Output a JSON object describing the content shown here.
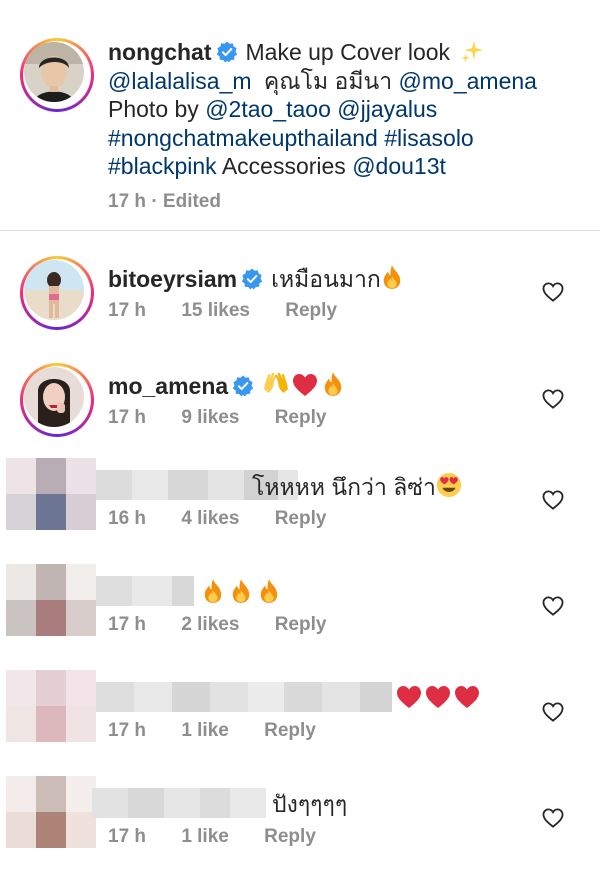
{
  "caption": {
    "username": "nongchat",
    "line1_text": "Make up Cover look",
    "line1_emoji": "sparkles",
    "line2_mention1": "@lalalalisa_m",
    "line2_text": "คุณโม อมีนา",
    "line2_mention2": "@mo_amena",
    "line3_text": "Photo by",
    "line3_mention1": "@2tao_taoo",
    "line3_mention2": "@jjayalus",
    "line4_tag1": "#nongchatmakeupthailand",
    "line4_tag2": "#lisasolo",
    "line5_tag": "#blackpink",
    "line5_text": "Accessories",
    "line5_mention": "@dou13t",
    "time": "17 h",
    "separator": "·",
    "edited": "Edited"
  },
  "comments": [
    {
      "username": "bitoeyrsiam",
      "verified": true,
      "text": "เหมือนมาก",
      "emojis": [
        "fire"
      ],
      "time": "17 h",
      "likes": "15 likes",
      "reply": "Reply"
    },
    {
      "username": "mo_amena",
      "verified": true,
      "text": "",
      "emojis": [
        "raising-hands",
        "red-heart",
        "fire"
      ],
      "time": "17 h",
      "likes": "9 likes",
      "reply": "Reply"
    },
    {
      "username": "",
      "verified": false,
      "text": "โหหหห นึกว่า ลิซ่า",
      "emojis": [
        "heart-eyes"
      ],
      "time": "16 h",
      "likes": "4 likes",
      "reply": "Reply"
    },
    {
      "username": "",
      "verified": false,
      "text": "",
      "emojis": [
        "fire",
        "fire",
        "fire"
      ],
      "time": "17 h",
      "likes": "2 likes",
      "reply": "Reply"
    },
    {
      "username": "",
      "verified": false,
      "text": "",
      "emojis": [
        "red-heart",
        "red-heart",
        "red-heart"
      ],
      "time": "17 h",
      "likes": "1 like",
      "reply": "Reply"
    },
    {
      "username": "",
      "verified": false,
      "text": "ปังๆๆๆๆ",
      "emojis": [],
      "time": "17 h",
      "likes": "1 like",
      "reply": "Reply"
    }
  ],
  "colors": {
    "verified_blue": "#3897f0",
    "link_blue": "#00376b",
    "meta_gray": "#8e8e8e",
    "text": "#262626"
  }
}
